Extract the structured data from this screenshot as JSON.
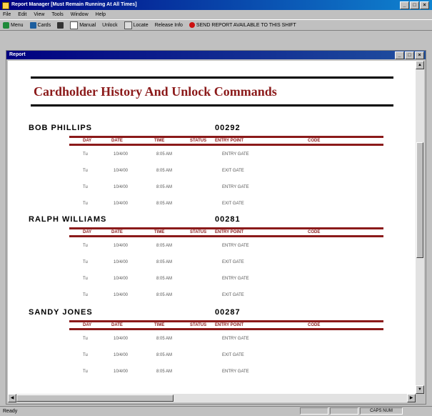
{
  "app": {
    "title": "Report Manager   [Must Remain Running At All Times]",
    "controls": {
      "minimize": "_",
      "maximize": "□",
      "close": "×"
    }
  },
  "menu": [
    "File",
    "Edit",
    "View",
    "Tools",
    "Window",
    "Help"
  ],
  "toolbar": [
    {
      "label": "Menu",
      "icon": "menu-icon"
    },
    {
      "label": "Cards",
      "icon": "cards-icon"
    },
    {
      "label": "",
      "icon": "print-icon"
    },
    {
      "label": "Manual",
      "icon": "status-icon"
    },
    {
      "label": "Unlock",
      "icon": "unlock-icon"
    },
    {
      "label": "Locate",
      "icon": "locate-icon"
    },
    {
      "label": "Release Info",
      "icon": ""
    },
    {
      "label": "SEND REPORT AVAILABLE TO THIS SHIFT",
      "icon": "red-dot-icon"
    }
  ],
  "report_window": {
    "title": "Report"
  },
  "report": {
    "title": "Cardholder History And Unlock Commands",
    "columns": [
      "DAY",
      "DATE",
      "TIME",
      "STATUS",
      "ENTRY POINT",
      "CODE"
    ],
    "people": [
      {
        "name": "BOB PHILLIPS",
        "id": "00292",
        "rows": [
          {
            "day": "Tu",
            "date": "10/4/00",
            "time": "8:05 AM",
            "entry": "ENTRY GATE"
          },
          {
            "day": "Tu",
            "date": "10/4/00",
            "time": "8:05 AM",
            "entry": "EXIT GATE"
          },
          {
            "day": "Tu",
            "date": "10/4/00",
            "time": "8:05 AM",
            "entry": "ENTRY GATE"
          },
          {
            "day": "Tu",
            "date": "10/4/00",
            "time": "8:05 AM",
            "entry": "EXIT GATE"
          }
        ]
      },
      {
        "name": "RALPH WILLIAMS",
        "id": "00281",
        "rows": [
          {
            "day": "Tu",
            "date": "10/4/00",
            "time": "8:05 AM",
            "entry": "ENTRY GATE"
          },
          {
            "day": "Tu",
            "date": "10/4/00",
            "time": "8:05 AM",
            "entry": "EXIT GATE"
          },
          {
            "day": "Tu",
            "date": "10/4/00",
            "time": "8:05 AM",
            "entry": "ENTRY GATE"
          },
          {
            "day": "Tu",
            "date": "10/4/00",
            "time": "8:05 AM",
            "entry": "EXIT GATE"
          }
        ]
      },
      {
        "name": "SANDY JONES",
        "id": "00287",
        "rows": [
          {
            "day": "Tu",
            "date": "10/4/00",
            "time": "8:05 AM",
            "entry": "ENTRY GATE"
          },
          {
            "day": "Tu",
            "date": "10/4/00",
            "time": "8:05 AM",
            "entry": "EXIT GATE"
          },
          {
            "day": "Tu",
            "date": "10/4/00",
            "time": "8:05 AM",
            "entry": "ENTRY GATE"
          }
        ]
      }
    ]
  },
  "status": {
    "left": "Ready",
    "right": "CAPS NUM"
  },
  "colors": {
    "accent": "#8b1a1a",
    "titlebar": "#000080"
  }
}
